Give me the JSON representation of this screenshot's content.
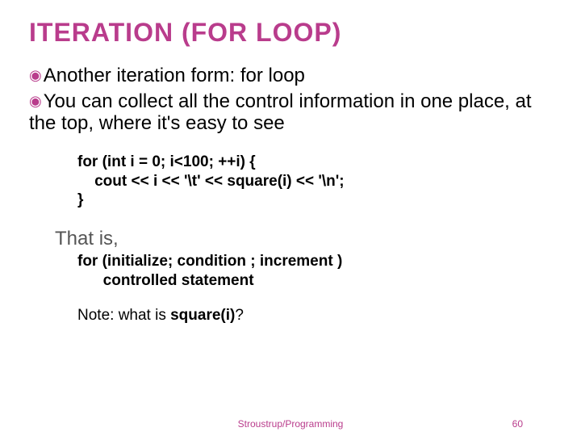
{
  "title": "ITERATION (FOR LOOP)",
  "bullets": [
    {
      "pre": "Another iteration form: ",
      "kw": "for",
      "post": " loop"
    },
    {
      "pre": "You can collect all the control information in one place, at the top, where it's easy to see",
      "kw": "",
      "post": ""
    }
  ],
  "code_lines": {
    "l1": "for (int i = 0; i<100; ++i) {",
    "l2": "    cout << i << '\\t' << square(i) << '\\n';",
    "l3": "}"
  },
  "that_is": "That is,",
  "syntax_lines": {
    "s1": "for (initialize; condition ; increment )",
    "s2": "      controlled statement"
  },
  "note": {
    "pre": "Note: what is ",
    "q": "square(i)",
    "post": "?"
  },
  "footer": {
    "credit": "Stroustrup/Programming",
    "page": "60"
  }
}
